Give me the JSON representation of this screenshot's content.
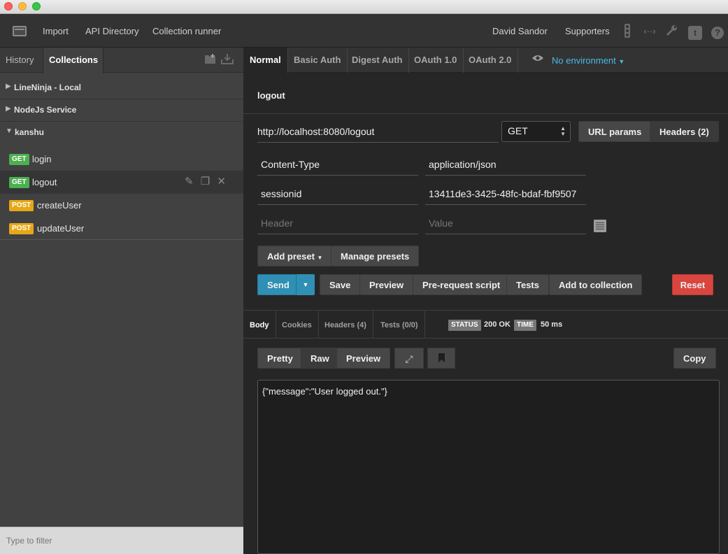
{
  "toolbar": {
    "import": "Import",
    "api_directory": "API Directory",
    "collection_runner": "Collection runner",
    "user": "David Sandor",
    "supporters": "Supporters",
    "icons": [
      "sidebar-toggle-icon",
      "traffic-light-icon",
      "code-icon",
      "wrench-icon",
      "twitter-icon",
      "help-icon"
    ]
  },
  "sidebar": {
    "tabs": [
      "History",
      "Collections"
    ],
    "active_tab": "Collections",
    "collections": [
      {
        "name": "LineNinja - Local",
        "expanded": false
      },
      {
        "name": "NodeJs Service",
        "expanded": false
      },
      {
        "name": "kanshu",
        "expanded": true
      }
    ],
    "requests": [
      {
        "method": "GET",
        "name": "login"
      },
      {
        "method": "GET",
        "name": "logout",
        "active": true
      },
      {
        "method": "POST",
        "name": "createUser"
      },
      {
        "method": "POST",
        "name": "updateUser"
      }
    ],
    "filter_placeholder": "Type to filter"
  },
  "auth_tabs": [
    "Normal",
    "Basic Auth",
    "Digest Auth",
    "OAuth 1.0",
    "OAuth 2.0"
  ],
  "environment": "No environment",
  "request": {
    "title": "logout",
    "url": "http://localhost:8080/logout",
    "method": "GET",
    "url_params_label": "URL params",
    "headers_label": "Headers (2)",
    "headers": [
      {
        "key": "Content-Type",
        "value": "application/json"
      },
      {
        "key": "sessionid",
        "value": "13411de3-3425-48fc-bdaf-fbf9507"
      }
    ],
    "header_placeholder": "Header",
    "value_placeholder": "Value"
  },
  "buttons": {
    "add_preset": "Add preset",
    "manage_presets": "Manage presets",
    "send": "Send",
    "save": "Save",
    "preview": "Preview",
    "pre_request": "Pre-request script",
    "tests": "Tests",
    "add_to_collection": "Add to collection",
    "reset": "Reset"
  },
  "response": {
    "tabs": [
      "Body",
      "Cookies",
      "Headers (4)",
      "Tests (0/0)"
    ],
    "status_label": "STATUS",
    "status_value": "200 OK",
    "time_label": "TIME",
    "time_value": "50 ms",
    "views": [
      "Pretty",
      "Raw",
      "Preview"
    ],
    "active_view": "Raw",
    "copy": "Copy",
    "body": "{\"message\":\"User logged out.\"}"
  },
  "colors": {
    "accent_blue": "#2f8fb5",
    "link_blue": "#4db8e8",
    "get_green": "#4caf50",
    "post_orange": "#e6a817",
    "reset_red": "#d9453f"
  }
}
